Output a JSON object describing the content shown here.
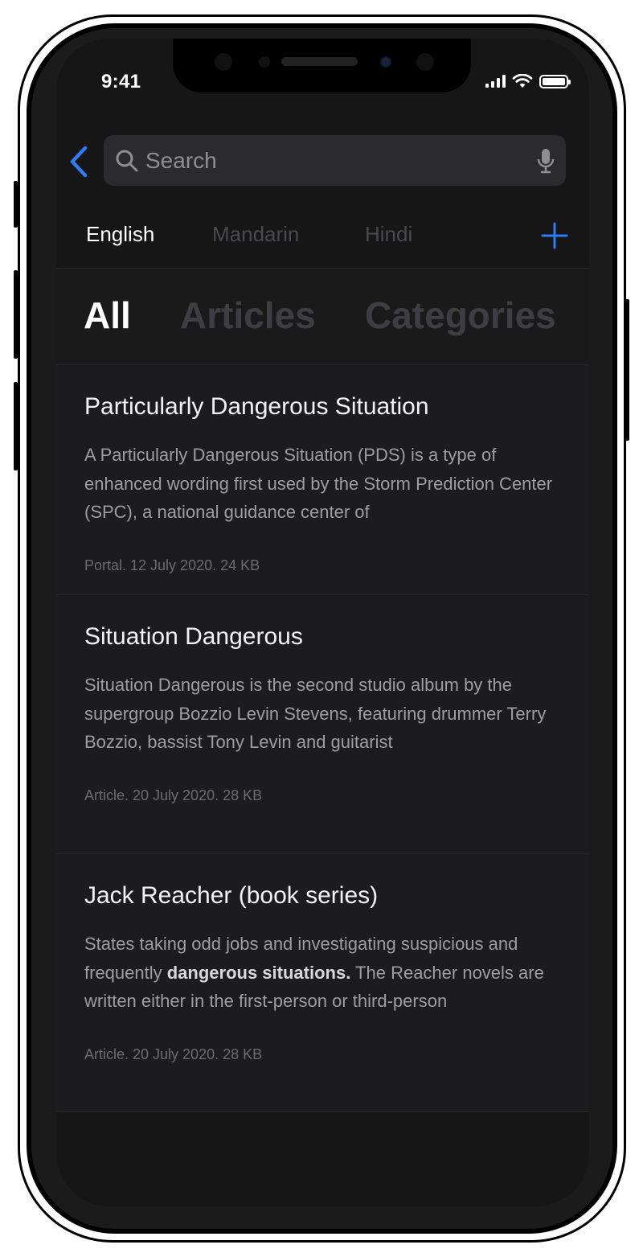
{
  "status": {
    "time": "9:41"
  },
  "search": {
    "placeholder": "Search"
  },
  "language_tabs": [
    "English",
    "Mandarin",
    "Hindi"
  ],
  "section_tabs": [
    "All",
    "Articles",
    "Categories"
  ],
  "results": [
    {
      "title": "Particularly Dangerous Situation",
      "snippet": "A Particularly Dangerous Situation (PDS) is a type of enhanced wording first used by the Storm Prediction Center (SPC), a national guidance center of",
      "meta": "Portal. 12 July 2020. 24 KB"
    },
    {
      "title": "Situation Dangerous",
      "snippet": "Situation Dangerous is the second studio album by the supergroup Bozzio Levin Stevens, featuring drummer Terry Bozzio, bassist Tony Levin and guitarist",
      "meta": "Article. 20 July 2020. 28 KB"
    },
    {
      "title": "Jack Reacher (book series)",
      "snippet_before": "States taking odd jobs and investigating suspicious and frequently ",
      "snippet_bold": "dangerous situations.",
      "snippet_after": " The Reacher novels are written either in the first-person or third-person",
      "meta": "Article. 20 July 2020. 28 KB"
    }
  ],
  "colors": {
    "accent": "#2f7cf6",
    "background": "#161617",
    "card": "#1c1c1e"
  },
  "icons": [
    "back-chevron-icon",
    "search-icon",
    "mic-icon",
    "plus-icon",
    "signal-icon",
    "wifi-icon",
    "battery-icon"
  ]
}
